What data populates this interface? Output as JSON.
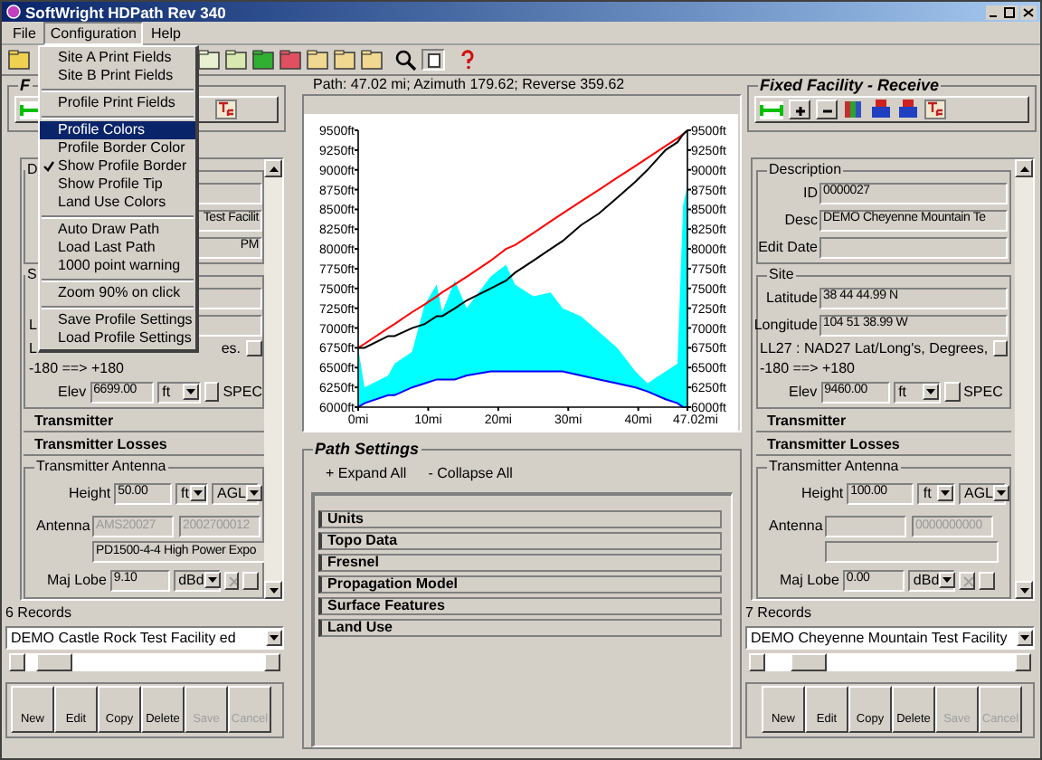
{
  "window": {
    "title": "SoftWright HDPath Rev 340"
  },
  "menu_bar": [
    {
      "label": "File",
      "selected": false
    },
    {
      "label": "Configuration",
      "selected": true
    },
    {
      "label": "Help",
      "selected": false
    }
  ],
  "menu": [
    {
      "kind": "item",
      "label": "Site A Print Fields",
      "selected": false,
      "checked": false
    },
    {
      "kind": "item",
      "label": "Site B Print Fields",
      "selected": false,
      "checked": false
    },
    {
      "kind": "separator"
    },
    {
      "kind": "item",
      "label": "Profile Print Fields",
      "selected": false,
      "checked": false
    },
    {
      "kind": "separator"
    },
    {
      "kind": "item",
      "label": "Profile Colors",
      "selected": true,
      "checked": false
    },
    {
      "kind": "item",
      "label": "Profile Border Color",
      "selected": false,
      "checked": false
    },
    {
      "kind": "item",
      "label": "Show Profile Border",
      "selected": false,
      "checked": true
    },
    {
      "kind": "item",
      "label": "Show Profile Tip",
      "selected": false,
      "checked": false
    },
    {
      "kind": "item",
      "label": "Land Use Colors",
      "selected": false,
      "checked": false
    },
    {
      "kind": "separator"
    },
    {
      "kind": "item",
      "label": "Auto Draw Path",
      "selected": false,
      "checked": false
    },
    {
      "kind": "item",
      "label": "Load Last Path",
      "selected": false,
      "checked": false
    },
    {
      "kind": "item",
      "label": "1000 point warning",
      "selected": false,
      "checked": false
    },
    {
      "kind": "separator"
    },
    {
      "kind": "item",
      "label": "Zoom 90% on click",
      "selected": false,
      "checked": false
    },
    {
      "kind": "separator"
    },
    {
      "kind": "item",
      "label": "Save Profile Settings",
      "selected": false,
      "checked": false
    },
    {
      "kind": "item",
      "label": "Load Profile Settings",
      "selected": false,
      "checked": false
    }
  ],
  "path_info": "Path: 47.02 mi; Azimuth 179.62; Reverse 359.62",
  "chart_data": {
    "type": "line",
    "x": [
      0,
      0.9,
      4.3,
      5.2,
      7.7,
      9.5,
      11.2,
      12,
      13.8,
      15.5,
      18.9,
      21.1,
      22.4,
      25,
      27.5,
      29.2,
      31.8,
      34.4,
      37,
      39.6,
      41.3,
      43.9,
      45.6,
      46.4,
      47.02
    ],
    "series": [
      {
        "type": "area",
        "color": "#00ffff",
        "values": [
          6750,
          6250,
          6400,
          6550,
          6700,
          7300,
          7550,
          7200,
          7600,
          7250,
          7650,
          7800,
          7550,
          7400,
          7450,
          7250,
          7150,
          6950,
          6750,
          6450,
          6300,
          6450,
          6550,
          8550,
          8800
        ]
      },
      {
        "type": "line",
        "color": "#ff0000",
        "values": [
          6750,
          6800,
          7000,
          7050,
          7200,
          7300,
          7400,
          7450,
          7550,
          7650,
          7850,
          8000,
          8050,
          8200,
          8350,
          8450,
          8600,
          8750,
          8900,
          9050,
          9150,
          9300,
          9400,
          9450,
          9500
        ]
      },
      {
        "type": "line",
        "color": "#000000",
        "values": [
          6750,
          6750,
          6900,
          6900,
          7000,
          7050,
          7150,
          7150,
          7250,
          7350,
          7500,
          7600,
          7700,
          7850,
          8000,
          8100,
          8300,
          8450,
          8650,
          8850,
          9000,
          9250,
          9350,
          9450,
          9500
        ]
      },
      {
        "type": "line",
        "color": "#0000ff",
        "values": [
          6000,
          6050,
          6150,
          6150,
          6250,
          6300,
          6350,
          6350,
          6350,
          6400,
          6450,
          6450,
          6450,
          6450,
          6450,
          6450,
          6400,
          6350,
          6300,
          6250,
          6200,
          6100,
          6050,
          6000,
          6000
        ]
      }
    ],
    "xlim": [
      0,
      47.02
    ],
    "ylim": [
      6000,
      9500
    ],
    "y2lim": [
      6000,
      9500
    ],
    "xticks": [
      {
        "value": 0,
        "label": "0mi"
      },
      {
        "value": 10,
        "label": "10mi"
      },
      {
        "value": 20,
        "label": "20mi"
      },
      {
        "value": 30,
        "label": "30mi"
      },
      {
        "value": 40,
        "label": "40mi"
      },
      {
        "value": 47.02,
        "label": "47.02mi"
      }
    ],
    "yticks": [
      {
        "value": 9500,
        "label": "9500ft"
      },
      {
        "value": 9250,
        "label": "9250ft"
      },
      {
        "value": 9000,
        "label": "9000ft"
      },
      {
        "value": 8750,
        "label": "8750ft"
      },
      {
        "value": 8500,
        "label": "8500ft"
      },
      {
        "value": 8250,
        "label": "8250ft"
      },
      {
        "value": 8000,
        "label": "8000ft"
      },
      {
        "value": 7750,
        "label": "7750ft"
      },
      {
        "value": 7500,
        "label": "7500ft"
      },
      {
        "value": 7250,
        "label": "7250ft"
      },
      {
        "value": 7000,
        "label": "7000ft"
      },
      {
        "value": 6750,
        "label": "6750ft"
      },
      {
        "value": 6500,
        "label": "6500ft"
      },
      {
        "value": 6250,
        "label": "6250ft"
      },
      {
        "value": 6000,
        "label": "6000ft"
      }
    ],
    "y2ticks": [
      {
        "value": 9500,
        "label": "9500ft"
      },
      {
        "value": 9250,
        "label": "9250ft"
      },
      {
        "value": 9000,
        "label": "9000ft"
      },
      {
        "value": 8750,
        "label": "8750ft"
      },
      {
        "value": 8500,
        "label": "8500ft"
      },
      {
        "value": 8250,
        "label": "8250ft"
      },
      {
        "value": 8000,
        "label": "8000ft"
      },
      {
        "value": 7750,
        "label": "7750ft"
      },
      {
        "value": 7500,
        "label": "7500ft"
      },
      {
        "value": 7250,
        "label": "7250ft"
      },
      {
        "value": 7000,
        "label": "7000ft"
      },
      {
        "value": 6750,
        "label": "6750ft"
      },
      {
        "value": 6500,
        "label": "6500ft"
      },
      {
        "value": 6250,
        "label": "6250ft"
      },
      {
        "value": 6000,
        "label": "6000ft"
      }
    ]
  },
  "path_settings": {
    "legend": "Path Settings",
    "expand": "+ Expand All",
    "collapse": "- Collapse All",
    "sections": [
      "Units",
      "Topo Data",
      "Fresnel",
      "Propagation Model",
      "Surface Features",
      "Land Use"
    ]
  },
  "sites": [
    {
      "header": "F",
      "description": {
        "legend": "D",
        "rows": [
          {},
          {
            "value": "Test Facilit"
          },
          {
            "value": "PM"
          }
        ]
      },
      "site": {
        "legend": "S",
        "rows": [
          {},
          {
            "label": "L"
          }
        ],
        "note": [
          "L",
          "es."
        ],
        "range": "-180 ==> +180",
        "elev": {
          "label": "Elev",
          "value": "6699.00",
          "unit": "ft",
          "spec": "SPEC"
        }
      },
      "sections": [
        "Transmitter",
        "Transmitter Losses"
      ],
      "antenna": {
        "legend": "Transmitter Antenna",
        "height": {
          "label": "Height",
          "value": "50.00",
          "unit": "ft",
          "ref": "AGL"
        },
        "label": "Antenna",
        "code_1": "AMS20027",
        "code_2": "2002700012",
        "model": "PD1500-4-4 High Power Expo",
        "maj_lobe": {
          "label": "Maj Lobe",
          "value": "9.10",
          "unit": "dBd"
        }
      },
      "records": "6 Records",
      "record": "DEMO Castle Rock Test Facility ed",
      "buttons": [
        {
          "label": "New",
          "disabled": false
        },
        {
          "label": "Edit",
          "disabled": false
        },
        {
          "label": "Copy",
          "disabled": false
        },
        {
          "label": "Delete",
          "disabled": false
        },
        {
          "label": "Save",
          "disabled": true
        },
        {
          "label": "Cancel",
          "disabled": true
        }
      ]
    },
    {
      "header": "Fixed Facility - Receive",
      "description": {
        "legend": "Description",
        "rows": [
          {
            "label": "ID",
            "value": "0000027"
          },
          {
            "label": "Desc",
            "value": "DEMO Cheyenne Mountain Te"
          },
          {
            "label": "Edit Date"
          }
        ]
      },
      "site": {
        "legend": "Site",
        "rows": [
          {
            "label": "Latitude",
            "value": "38 44 44.99 N"
          },
          {
            "label": "Longitude",
            "value": "104 51 38.99 W"
          }
        ],
        "note": [
          "LL27 : NAD27 Lat/Long's, Degrees,"
        ],
        "range": "-180 ==> +180",
        "elev": {
          "label": "Elev",
          "value": "9460.00",
          "unit": "ft",
          "spec": "SPEC"
        }
      },
      "sections": [
        "Transmitter",
        "Transmitter Losses"
      ],
      "antenna": {
        "legend": "Transmitter Antenna",
        "height": {
          "label": "Height",
          "value": "100.00",
          "unit": "ft",
          "ref": "AGL"
        },
        "label": "Antenna",
        "code_2": "0000000000",
        "maj_lobe": {
          "label": "Maj Lobe",
          "value": "0.00",
          "unit": "dBd"
        }
      },
      "records": "7 Records",
      "record": "DEMO Cheyenne Mountain Test Facility",
      "buttons": [
        {
          "label": "New",
          "disabled": false
        },
        {
          "label": "Edit",
          "disabled": false
        },
        {
          "label": "Copy",
          "disabled": false
        },
        {
          "label": "Delete",
          "disabled": false
        },
        {
          "label": "Save",
          "disabled": true
        },
        {
          "label": "Cancel",
          "disabled": true
        }
      ]
    }
  ]
}
